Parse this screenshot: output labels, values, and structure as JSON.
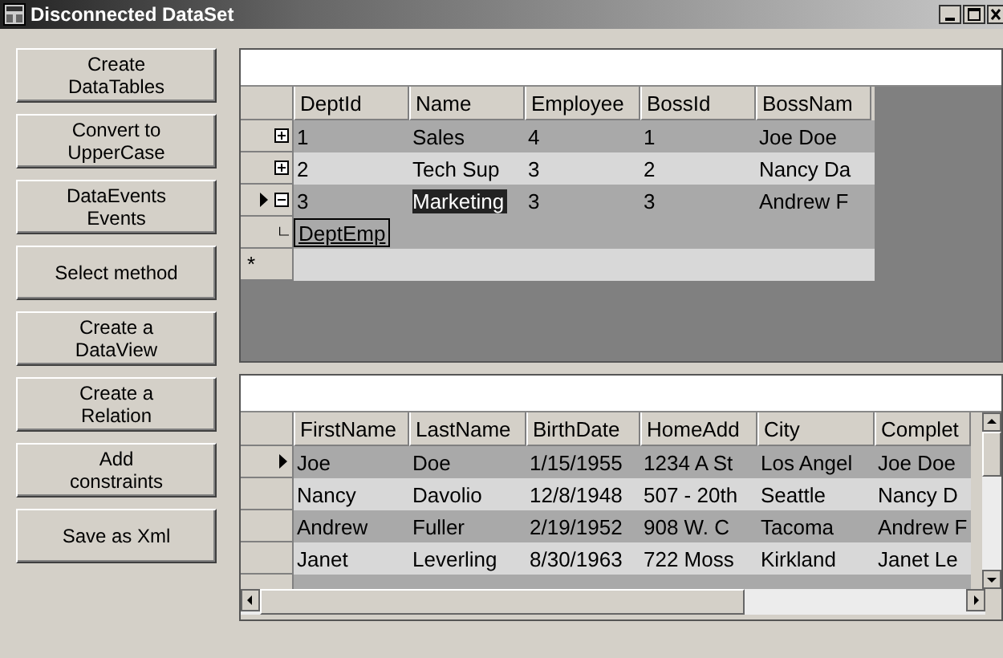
{
  "window": {
    "title": "Disconnected DataSet"
  },
  "buttons": [
    "Create DataTables",
    "Convert to UpperCase",
    "DataEvents Events",
    "Select method",
    "Create a DataView",
    "Create a Relation",
    "Add constraints",
    "Save as Xml"
  ],
  "master_grid": {
    "columns": [
      "DeptId",
      "Name",
      "Employee",
      "BossId",
      "BossNam"
    ],
    "rows": [
      {
        "current": false,
        "expanded": false,
        "cells": [
          {
            "text": "1",
            "selected": false
          },
          {
            "text": "Sales",
            "selected": false
          },
          {
            "text": "4",
            "selected": false
          },
          {
            "text": "1",
            "selected": false
          },
          {
            "text": "Joe Doe",
            "selected": false
          }
        ]
      },
      {
        "current": false,
        "expanded": false,
        "cells": [
          {
            "text": "2",
            "selected": false
          },
          {
            "text": "Tech Sup",
            "selected": false
          },
          {
            "text": "3",
            "selected": false
          },
          {
            "text": "2",
            "selected": false
          },
          {
            "text": "Nancy Da",
            "selected": false
          }
        ]
      },
      {
        "current": true,
        "expanded": true,
        "relation": "DeptEmp",
        "cells": [
          {
            "text": "3",
            "selected": false
          },
          {
            "text": "Marketing",
            "selected": true
          },
          {
            "text": "3",
            "selected": false
          },
          {
            "text": "3",
            "selected": false
          },
          {
            "text": "Andrew F",
            "selected": false
          }
        ]
      }
    ],
    "new_row_marker": "*"
  },
  "detail_grid": {
    "columns": [
      "FirstName",
      "LastName",
      "BirthDate",
      "HomeAdd",
      "City",
      "Complet"
    ],
    "rows": [
      {
        "current": true,
        "cells": [
          "Joe",
          "Doe",
          "1/15/1955",
          "1234 A St",
          "Los Angel",
          "Joe Doe"
        ]
      },
      {
        "current": false,
        "cells": [
          "Nancy",
          "Davolio",
          "12/8/1948",
          "507 - 20th",
          "Seattle",
          "Nancy D"
        ]
      },
      {
        "current": false,
        "cells": [
          "Andrew",
          "Fuller",
          "2/19/1952",
          "908 W. C",
          "Tacoma",
          "Andrew F"
        ]
      },
      {
        "current": false,
        "cells": [
          "Janet",
          "Leverling",
          "8/30/1963",
          "722 Moss",
          "Kirkland",
          "Janet Le"
        ]
      }
    ]
  }
}
